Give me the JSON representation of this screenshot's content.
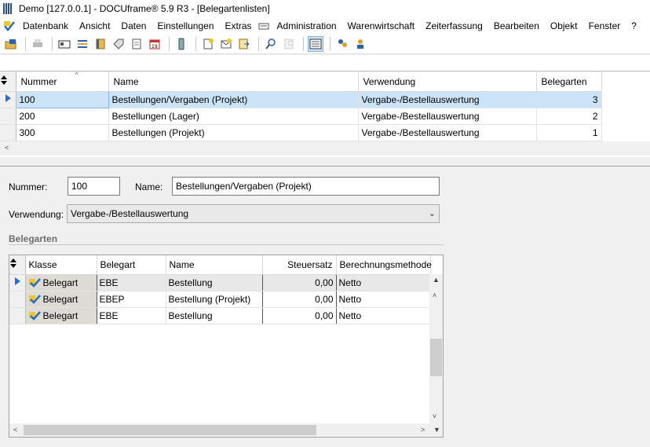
{
  "window": {
    "title": "Demo [127.0.0.1] - DOCUframe® 5.9 R3 - [Belegartenlisten]"
  },
  "menu": [
    "Datenbank",
    "Ansicht",
    "Daten",
    "Einstellungen",
    "Extras",
    "Administration",
    "Warenwirtschaft",
    "Zeiterfassung",
    "Bearbeiten",
    "Objekt",
    "Fenster",
    "?"
  ],
  "list": {
    "columns": [
      "Nummer",
      "Name",
      "Verwendung",
      "Belegarten"
    ],
    "rows": [
      {
        "nummer": "100",
        "name": "Bestellungen/Vergaben (Projekt)",
        "verwendung": "Vergabe-/Bestellauswertung",
        "belegarten": "3",
        "selected": true
      },
      {
        "nummer": "200",
        "name": "Bestellungen (Lager)",
        "verwendung": "Vergabe-/Bestellauswertung",
        "belegarten": "2",
        "selected": false
      },
      {
        "nummer": "300",
        "name": "Bestellungen (Projekt)",
        "verwendung": "Vergabe-/Bestellauswertung",
        "belegarten": "1",
        "selected": false
      }
    ]
  },
  "form": {
    "nummer_label": "Nummer:",
    "nummer_value": "100",
    "name_label": "Name:",
    "name_value": "Bestellungen/Vergaben (Projekt)",
    "verwendung_label": "Verwendung:",
    "verwendung_value": "Vergabe-/Bestellauswertung",
    "group_title": "Belegarten"
  },
  "belegarten": {
    "columns": [
      "Klasse",
      "Belegart",
      "Name",
      "Steuersatz",
      "Berechnungsmethode"
    ],
    "rows": [
      {
        "klasse": "Belegart",
        "belegart": "EBE",
        "name": "Bestellung",
        "steuersatz": "0,00",
        "methode": "Netto"
      },
      {
        "klasse": "Belegart",
        "belegart": "EBEP",
        "name": "Bestellung (Projekt)",
        "steuersatz": "0,00",
        "methode": "Netto"
      },
      {
        "klasse": "Belegart",
        "belegart": "EBE",
        "name": "Bestellung",
        "steuersatz": "0,00",
        "methode": "Netto"
      }
    ]
  },
  "colors": {
    "selection": "#cce4f7",
    "accent": "#1f6fd0"
  }
}
